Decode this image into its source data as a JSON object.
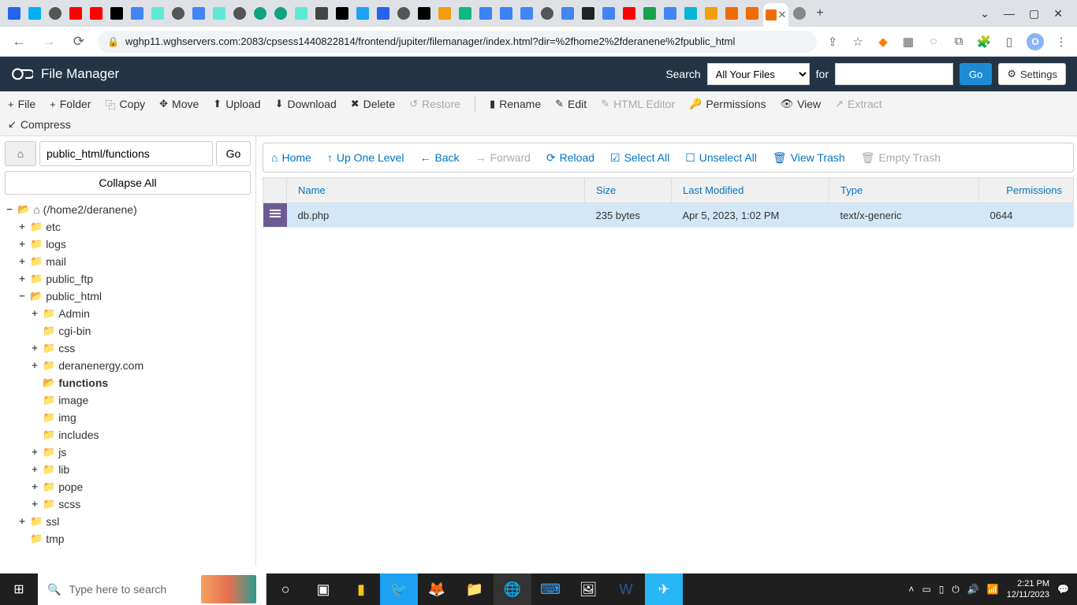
{
  "browser": {
    "url": "wghp11.wghservers.com:2083/cpsess1440822814/frontend/jupiter/filemanager/index.html?dir=%2fhome2%2fderanene%2fpublic_html",
    "avatar_letter": "O"
  },
  "header": {
    "title": "File Manager",
    "search_label": "Search",
    "select_value": "All Your Files",
    "for_label": "for",
    "go_label": "Go",
    "settings_label": "Settings"
  },
  "toolbar": {
    "file": "File",
    "folder": "Folder",
    "copy": "Copy",
    "move": "Move",
    "upload": "Upload",
    "download": "Download",
    "delete": "Delete",
    "restore": "Restore",
    "rename": "Rename",
    "edit": "Edit",
    "html_editor": "HTML Editor",
    "permissions": "Permissions",
    "view": "View",
    "extract": "Extract",
    "compress": "Compress"
  },
  "sidebar": {
    "path_value": "public_html/functions",
    "go_label": "Go",
    "collapse_label": "Collapse All",
    "root_label": "(/home2/deranene)",
    "nodes": {
      "etc": "etc",
      "logs": "logs",
      "mail": "mail",
      "public_ftp": "public_ftp",
      "public_html": "public_html",
      "admin": "Admin",
      "cgi_bin": "cgi-bin",
      "css": "css",
      "deranenergy": "deranenergy.com",
      "functions": "functions",
      "image": "image",
      "img": "img",
      "includes": "includes",
      "js": "js",
      "lib": "lib",
      "pope": "pope",
      "scss": "scss",
      "ssl": "ssl",
      "tmp": "tmp"
    }
  },
  "actionbar": {
    "home": "Home",
    "up": "Up One Level",
    "back": "Back",
    "forward": "Forward",
    "reload": "Reload",
    "select_all": "Select All",
    "unselect_all": "Unselect All",
    "view_trash": "View Trash",
    "empty_trash": "Empty Trash"
  },
  "table": {
    "cols": {
      "name": "Name",
      "size": "Size",
      "modified": "Last Modified",
      "type": "Type",
      "perms": "Permissions"
    },
    "rows": [
      {
        "name": "db.php",
        "size": "235 bytes",
        "modified": "Apr 5, 2023, 1:02 PM",
        "type": "text/x-generic",
        "perms": "0644"
      }
    ]
  },
  "taskbar": {
    "search_placeholder": "Type here to search",
    "time": "2:21 PM",
    "date": "12/11/2023"
  }
}
